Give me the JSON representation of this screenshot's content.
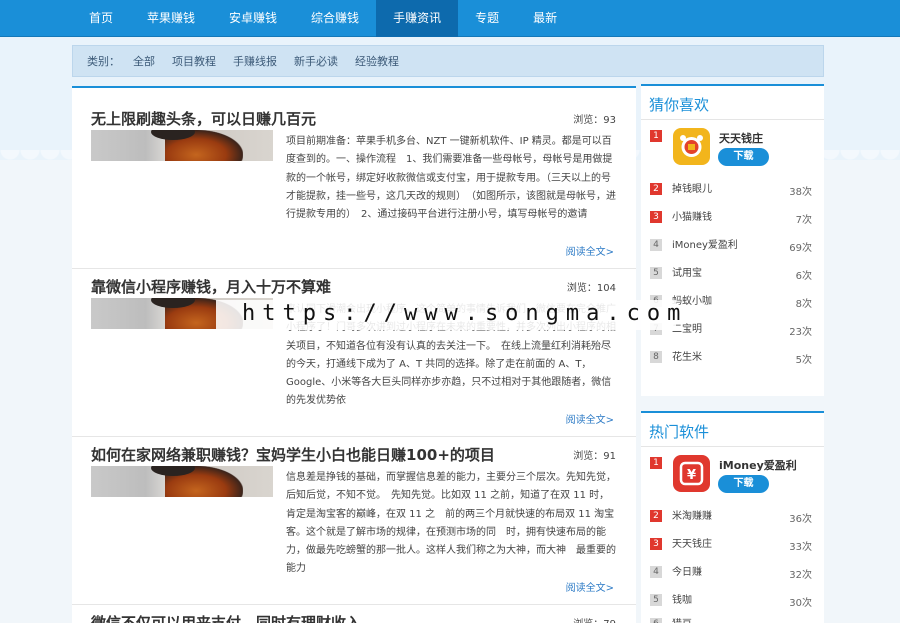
{
  "nav": {
    "items": [
      "首页",
      "苹果赚钱",
      "安卓赚钱",
      "综合赚钱",
      "手赚资讯",
      "专题",
      "最新"
    ],
    "active_index": 4
  },
  "categories": {
    "label": "类别：",
    "items": [
      "全部",
      "项目教程",
      "手赚线报",
      "新手必读",
      "经验教程"
    ]
  },
  "articles": [
    {
      "title": "无上限刷趣头条，可以日赚几百元",
      "views": "浏览：93",
      "excerpt": "项目前期准备：苹果手机多台、NZT 一键新机软件、IP 精灵。都是可以百度查到的。一、操作流程　1、我们需要准备一些母帐号，母帐号是用做提款的一个帐号，绑定好收款微信或支付宝，用于提款专用。（三天以上的号才能提款，挂一些号，这几天改的规则）　（如图所示，该图就是母帐号，进行提款专用的）　2、通过接码平台进行注册小号，填写母帐号的邀请",
      "readmore": "阅读全文>"
    },
    {
      "title": "靠微信小程序赚钱，月入十万不算难",
      "views": "浏览：104",
      "excerpt": "来认同下滑潮会出现小程序。这个简单的事情告诉我们，微信要在完全推广小程序了！门哥多次讲到过小程序在未来的重要性，并多次列出小程序的相关项目，不知道各位有没有认真的去关注一下。　在线上流量红利消耗殆尽的今天，打通线下成为了 A、T 共同的选择。除了走在前面的 A、T，Google、小米等各大巨头同样亦步亦趋，只不过相对于其他跟随者，微信的先发优势依",
      "readmore": "阅读全文>"
    },
    {
      "title": "如何在家网络兼职赚钱？宝妈学生小白也能日赚100+的项目",
      "views": "浏览：91",
      "excerpt": "信息差是挣钱的基础，而掌握信息差的能力，主要分三个层次。先知先觉，后知后觉，不知不觉。　先知先觉。比如双 11 之前，知道了在双 11 时，肯定是淘宝客的巅峰，在双 11 之　前的两三个月就快速的布局双 11 淘宝客。这个就是了解市场的规律，在预测市场的同　时，拥有快速布局的能力，做最先吃螃蟹的那一批人。这样人我们称之为大神，而大神　最重要的能力",
      "readmore": "阅读全文>"
    },
    {
      "title": "微信不仅可以用来支付，同时有理财收入",
      "views": "浏览：79"
    }
  ],
  "sidebar_guess": {
    "title": "猜你喜欢",
    "featured": {
      "rank": "1",
      "name": "天天钱庄",
      "button": "下载",
      "icon_color": "#f2b51c"
    },
    "items": [
      {
        "rank": "2",
        "name": "掉钱眼儿",
        "count": "38次"
      },
      {
        "rank": "3",
        "name": "小猫赚钱",
        "count": "7次"
      },
      {
        "rank": "4",
        "name": "iMoney爱盈利",
        "count": "69次"
      },
      {
        "rank": "5",
        "name": "试用宝",
        "count": "6次"
      },
      {
        "rank": "6",
        "name": "蚂蚁小咖",
        "count": "8次"
      },
      {
        "rank": "7",
        "name": "二宝明",
        "count": "23次"
      },
      {
        "rank": "8",
        "name": "花生米",
        "count": "5次"
      }
    ]
  },
  "sidebar_hot": {
    "title": "热门软件",
    "featured": {
      "rank": "1",
      "name": "iMoney爱盈利",
      "button": "下载",
      "icon_color": "#e0382e"
    },
    "items": [
      {
        "rank": "2",
        "name": "米淘赚赚",
        "count": "36次"
      },
      {
        "rank": "3",
        "name": "天天钱庄",
        "count": "33次"
      },
      {
        "rank": "4",
        "name": "今日赚",
        "count": "32次"
      },
      {
        "rank": "5",
        "name": "钱咖",
        "count": "30次"
      },
      {
        "rank": "6",
        "name": "猎豆",
        "count": ""
      }
    ]
  },
  "watermark": "https://www.songma.com",
  "colors": {
    "nav": "#1a8fd8",
    "nav_active": "#0d6aad",
    "accent": "#1a8fd8",
    "rank_hot": "#e0382e"
  }
}
